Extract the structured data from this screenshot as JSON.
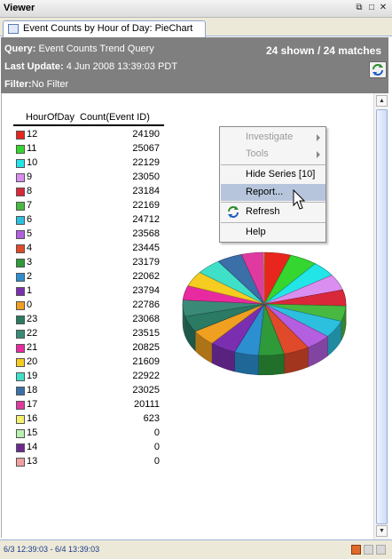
{
  "window": {
    "title": "Viewer"
  },
  "tab": {
    "label": "Event Counts by Hour of Day: PieChart"
  },
  "header": {
    "query_label": "Query:",
    "query_value": "Event Counts Trend Query",
    "count_text": "24 shown / 24 matches",
    "last_update_label": "Last Update:",
    "last_update_value": "4 Jun 2008 13:39:03 PDT",
    "filter_label": "Filter:",
    "filter_value": "No Filter"
  },
  "table": {
    "col_hour": "HourOfDay",
    "col_count": "Count(Event ID)",
    "rows": [
      {
        "hour": "12",
        "count": "24190",
        "color": "#e8261e"
      },
      {
        "hour": "11",
        "count": "25067",
        "color": "#35d62f"
      },
      {
        "hour": "10",
        "count": "22129",
        "color": "#22e5e8"
      },
      {
        "hour": "9",
        "count": "23050",
        "color": "#d98ef0"
      },
      {
        "hour": "8",
        "count": "23184",
        "color": "#d9283a"
      },
      {
        "hour": "7",
        "count": "22169",
        "color": "#47b940"
      },
      {
        "hour": "6",
        "count": "24712",
        "color": "#2dc0de"
      },
      {
        "hour": "5",
        "count": "23568",
        "color": "#b45ee0"
      },
      {
        "hour": "4",
        "count": "23445",
        "color": "#e04a2a"
      },
      {
        "hour": "3",
        "count": "23179",
        "color": "#2e9a3a"
      },
      {
        "hour": "2",
        "count": "22062",
        "color": "#2b8fd0"
      },
      {
        "hour": "1",
        "count": "23794",
        "color": "#7b2fb0"
      },
      {
        "hour": "0",
        "count": "22786",
        "color": "#f0a020"
      },
      {
        "hour": "23",
        "count": "23068",
        "color": "#2a7a64"
      },
      {
        "hour": "22",
        "count": "23515",
        "color": "#3a8a78"
      },
      {
        "hour": "21",
        "count": "20825",
        "color": "#e82aa0"
      },
      {
        "hour": "20",
        "count": "21609",
        "color": "#f5cc20"
      },
      {
        "hour": "19",
        "count": "22922",
        "color": "#40e0c8"
      },
      {
        "hour": "18",
        "count": "23025",
        "color": "#3a6fa8"
      },
      {
        "hour": "17",
        "count": "20111",
        "color": "#e03aa0"
      },
      {
        "hour": "16",
        "count": "623",
        "color": "#f4f070"
      },
      {
        "hour": "15",
        "count": "0",
        "color": "#b8f0b0"
      },
      {
        "hour": "14",
        "count": "0",
        "color": "#6a2a90"
      },
      {
        "hour": "13",
        "count": "0",
        "color": "#f0a0a0"
      }
    ]
  },
  "menu": {
    "investigate": "Investigate",
    "tools": "Tools",
    "hide_series": "Hide Series [10]",
    "report": "Report...",
    "refresh": "Refresh",
    "help": "Help"
  },
  "status": {
    "range": "6/3 12:39:03 - 6/4 13:39:03"
  }
}
